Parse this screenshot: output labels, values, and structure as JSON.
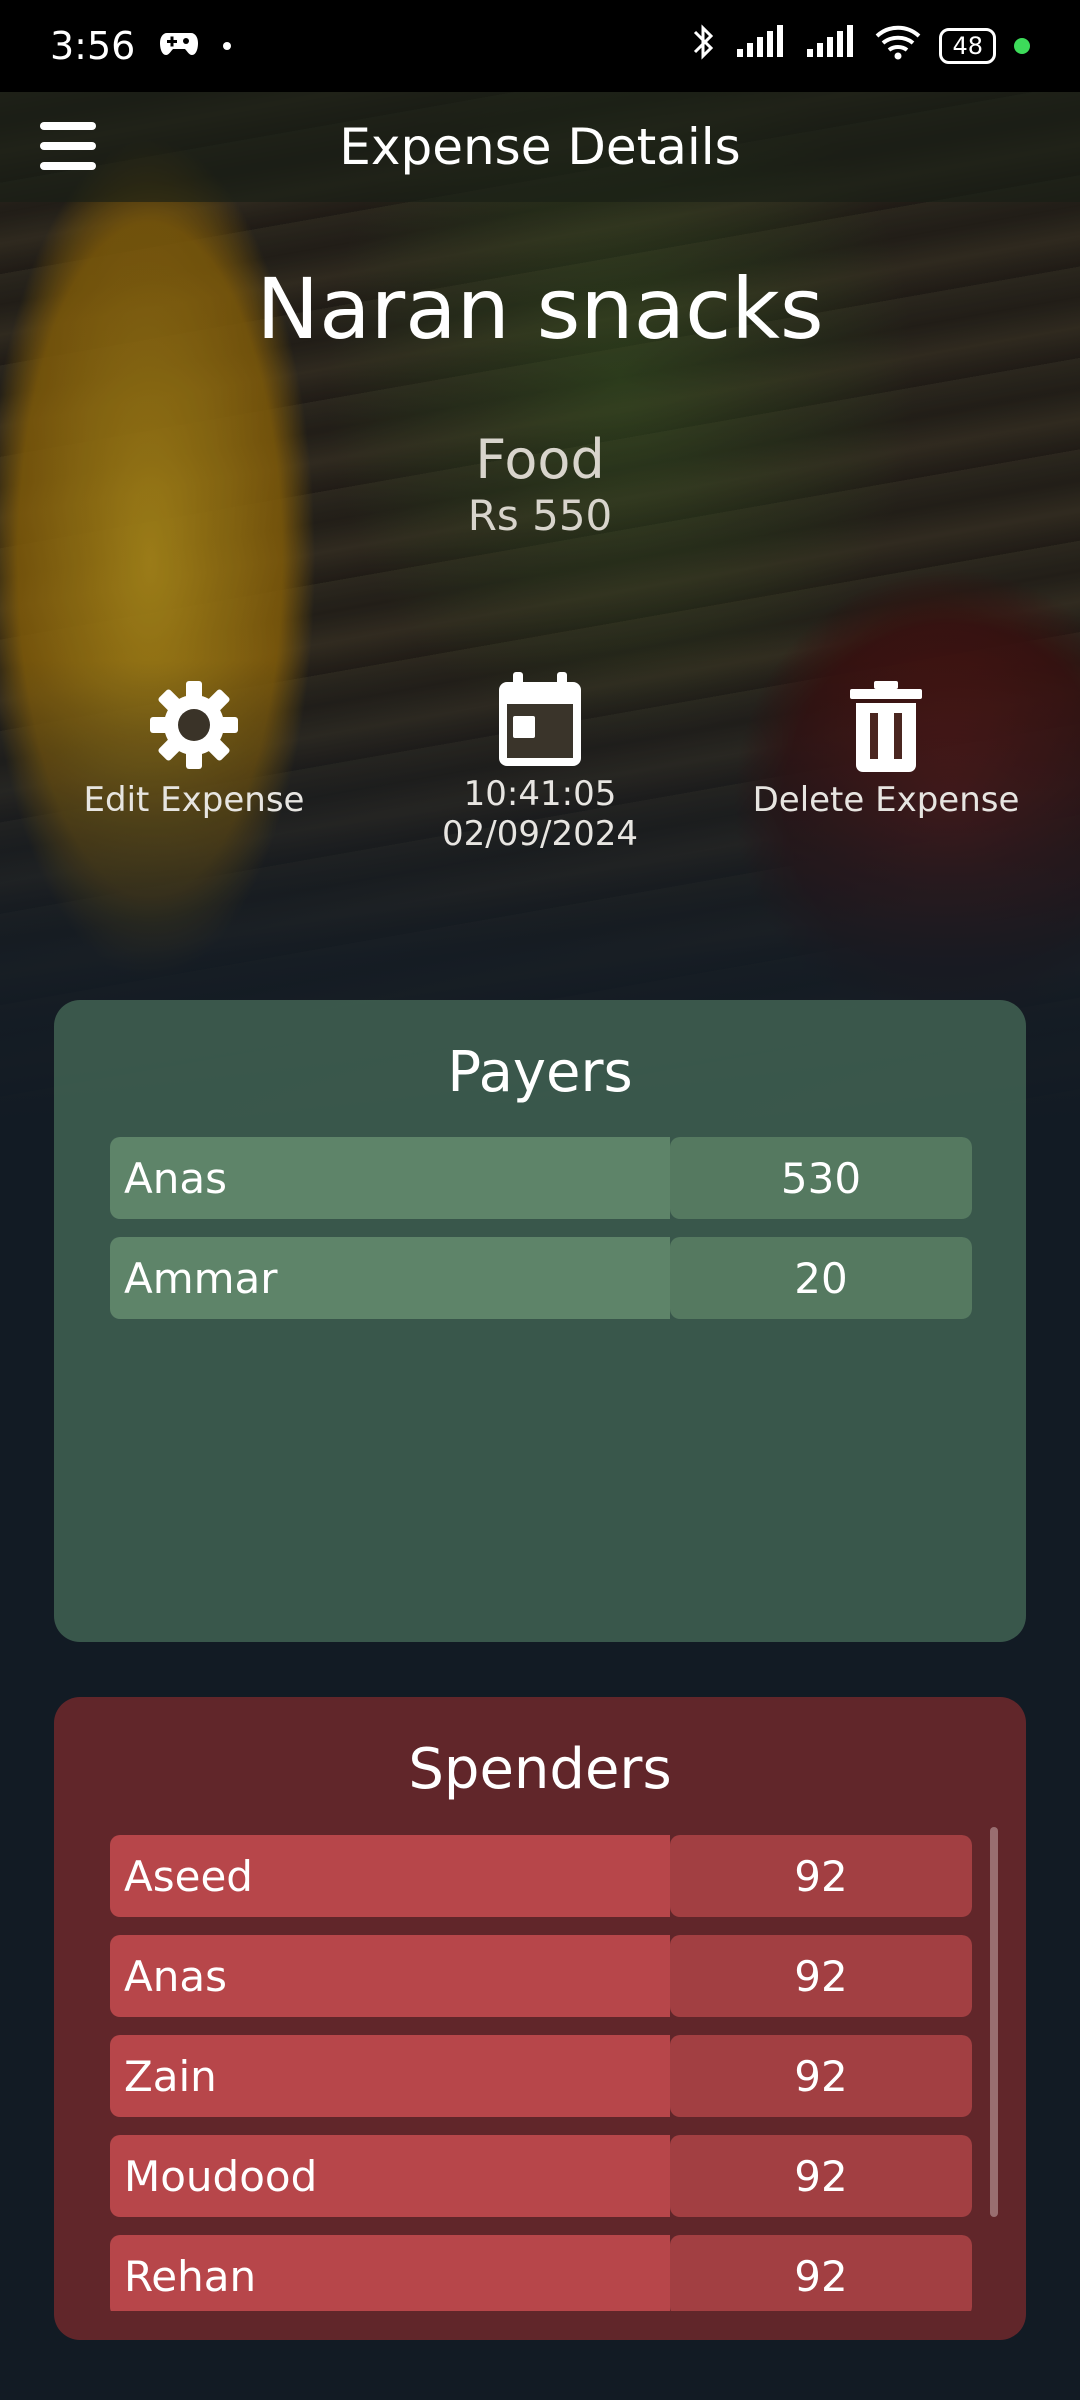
{
  "status_bar": {
    "time": "3:56",
    "battery": "48"
  },
  "app_bar": {
    "title": "Expense Details"
  },
  "expense": {
    "name": "Naran snacks",
    "category": "Food",
    "amount": "Rs 550",
    "time": "10:41:05",
    "date": "02/09/2024"
  },
  "actions": {
    "edit_label": "Edit Expense",
    "delete_label": "Delete Expense"
  },
  "payers": {
    "title": "Payers",
    "rows": [
      {
        "name": "Anas",
        "value": "530"
      },
      {
        "name": "Ammar",
        "value": "20"
      }
    ]
  },
  "spenders": {
    "title": "Spenders",
    "rows": [
      {
        "name": "Aseed",
        "value": "92"
      },
      {
        "name": "Anas",
        "value": "92"
      },
      {
        "name": "Zain",
        "value": "92"
      },
      {
        "name": "Moudood",
        "value": "92"
      },
      {
        "name": "Rehan",
        "value": "92"
      }
    ]
  },
  "colors": {
    "payers_card": "#4a705c",
    "spenders_card": "#70282c",
    "payer_row": "#5e8469",
    "spender_row": "#b7464a"
  },
  "icons": {
    "menu": "hamburger-icon",
    "edit": "gear-icon",
    "date": "calendar-icon",
    "delete": "trash-icon"
  }
}
